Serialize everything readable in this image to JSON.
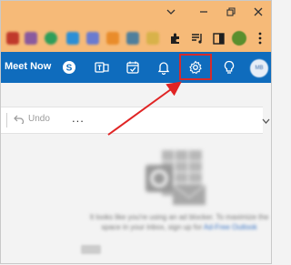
{
  "appbar": {
    "meet_now_label": "Meet Now",
    "icons": [
      "skype-icon",
      "teams-icon",
      "calendar-icon",
      "bell-icon",
      "gear-icon",
      "lightbulb-icon",
      "avatar"
    ],
    "accent_color": "#0f6cbd"
  },
  "cmdbar": {
    "undo_label": "Undo",
    "more_label": "..."
  },
  "reading_pane": {
    "ad_text": "It looks like you're using an ad blocker. To maximize the space in your inbox, sign up for",
    "ad_link": "Ad-Free Outlook"
  },
  "annotation": {
    "highlight_color": "#d52b2b"
  }
}
